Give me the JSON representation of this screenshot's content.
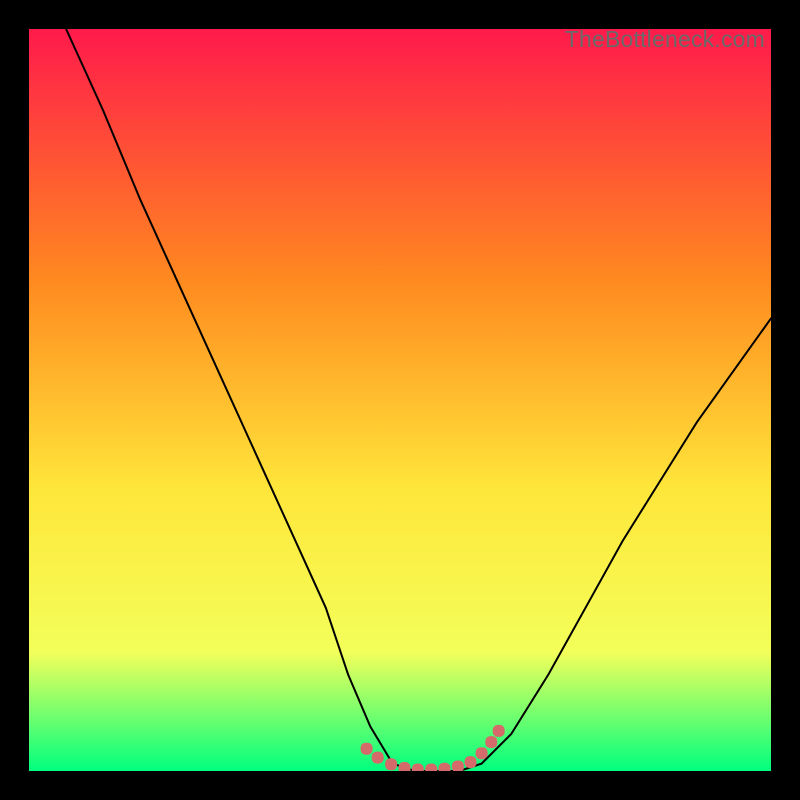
{
  "watermark": "TheBottleneck.com",
  "colors": {
    "gradient_top": "#ff1a4b",
    "gradient_mid1": "#ff8a1f",
    "gradient_mid2": "#ffe63a",
    "gradient_mid3": "#f3ff5a",
    "gradient_bottom": "#00ff7f",
    "curve": "#000000",
    "marker": "#d46a6a"
  },
  "chart_data": {
    "type": "line",
    "title": "",
    "xlabel": "",
    "ylabel": "",
    "xlim": [
      0,
      100
    ],
    "ylim": [
      0,
      100
    ],
    "series": [
      {
        "name": "bottleneck-curve",
        "x": [
          5,
          10,
          15,
          20,
          25,
          30,
          35,
          40,
          43,
          46,
          49,
          52,
          55,
          58,
          61,
          65,
          70,
          75,
          80,
          85,
          90,
          95,
          100
        ],
        "y": [
          100,
          89,
          77,
          66,
          55,
          44,
          33,
          22,
          13,
          6,
          1,
          0,
          0,
          0,
          1,
          5,
          13,
          22,
          31,
          39,
          47,
          54,
          61
        ]
      }
    ],
    "markers": [
      {
        "x": 45.5,
        "y": 3.0
      },
      {
        "x": 47.0,
        "y": 1.8
      },
      {
        "x": 48.8,
        "y": 0.9
      },
      {
        "x": 50.6,
        "y": 0.4
      },
      {
        "x": 52.4,
        "y": 0.2
      },
      {
        "x": 54.2,
        "y": 0.2
      },
      {
        "x": 56.0,
        "y": 0.3
      },
      {
        "x": 57.8,
        "y": 0.6
      },
      {
        "x": 59.5,
        "y": 1.2
      },
      {
        "x": 61.0,
        "y": 2.4
      },
      {
        "x": 62.3,
        "y": 3.9
      },
      {
        "x": 63.3,
        "y": 5.4
      }
    ]
  }
}
